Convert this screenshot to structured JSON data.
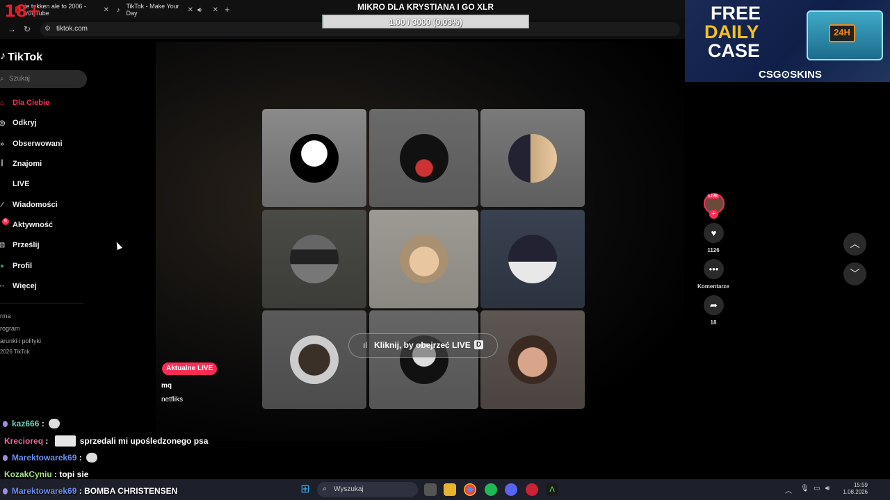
{
  "browser": {
    "badge": "18+",
    "tabs": [
      {
        "label": "ie tekken ale to 2006 - YouTube",
        "close": "✕"
      },
      {
        "label": "TikTok - Make Your Day",
        "close": "✕"
      },
      {
        "label": "",
        "close": "✕"
      }
    ],
    "new_tab": "+",
    "url": "tiktok.com"
  },
  "goal": {
    "title": "MIKRO DLA KRYSTIANA I GO XLR",
    "progress_text": "1.00 / 3000 (0.03%)",
    "progress_fraction": 0.0003
  },
  "ad": {
    "line1": "FREE",
    "line2": "DAILY",
    "line3": "CASE",
    "case_label": "24H",
    "brand": "CSG⊙SKINS"
  },
  "tiktok": {
    "logo": "TikTok",
    "search_placeholder": "Szukaj",
    "nav": [
      {
        "label": "Dla Ciebie",
        "icon": "home-icon",
        "active": true
      },
      {
        "label": "Odkryj",
        "icon": "compass-icon"
      },
      {
        "label": "Obserwowani",
        "icon": "following-icon"
      },
      {
        "label": "Znajomi",
        "icon": "friends-icon"
      },
      {
        "label": "LIVE",
        "icon": "live-icon"
      },
      {
        "label": "Wiadomości",
        "icon": "send-icon"
      },
      {
        "label": "Aktywność",
        "icon": "bell-icon"
      },
      {
        "label": "Prześlij",
        "icon": "upload-icon"
      },
      {
        "label": "Profil",
        "icon": "profile-icon"
      },
      {
        "label": "Więcej",
        "icon": "more-icon"
      }
    ],
    "notification_count": "6",
    "footer": [
      "rma",
      "rogram",
      "arunki i polityki",
      "2026 TikTok"
    ]
  },
  "live": {
    "button_label": "Kliknij, by obejrzeć LIVE",
    "shortcut_key": "D",
    "badge": "Aktualne LIVE",
    "author": "mq",
    "caption": "netfliks",
    "live_tag": "LIVE"
  },
  "actions": {
    "likes": "1126",
    "comments_label": "Komentarze",
    "shares": "18"
  },
  "chat": [
    {
      "user": "kaz666",
      "color": "#67d7b8",
      "message": "",
      "badge": true,
      "emote": true
    },
    {
      "user": "Krecioreq",
      "color": "#e8679c",
      "message": "sprzedali mi upośledzonego psa",
      "badge": false,
      "emote": true
    },
    {
      "user": "Marektowarek69",
      "color": "#6a8cf0",
      "message": "",
      "badge": true,
      "emote": true
    },
    {
      "user": "KozakCyniu",
      "color": "#a7e07a",
      "message": "topi sie",
      "badge": false,
      "emote": false
    },
    {
      "user": "Marektowarek69",
      "color": "#6a8cf0",
      "message": "BOMBA CHRISTENSEN",
      "badge": true,
      "emote": false
    }
  ],
  "taskbar": {
    "search_placeholder": "Wyszukaj",
    "time": "15:59",
    "date": "1.08.2026"
  }
}
